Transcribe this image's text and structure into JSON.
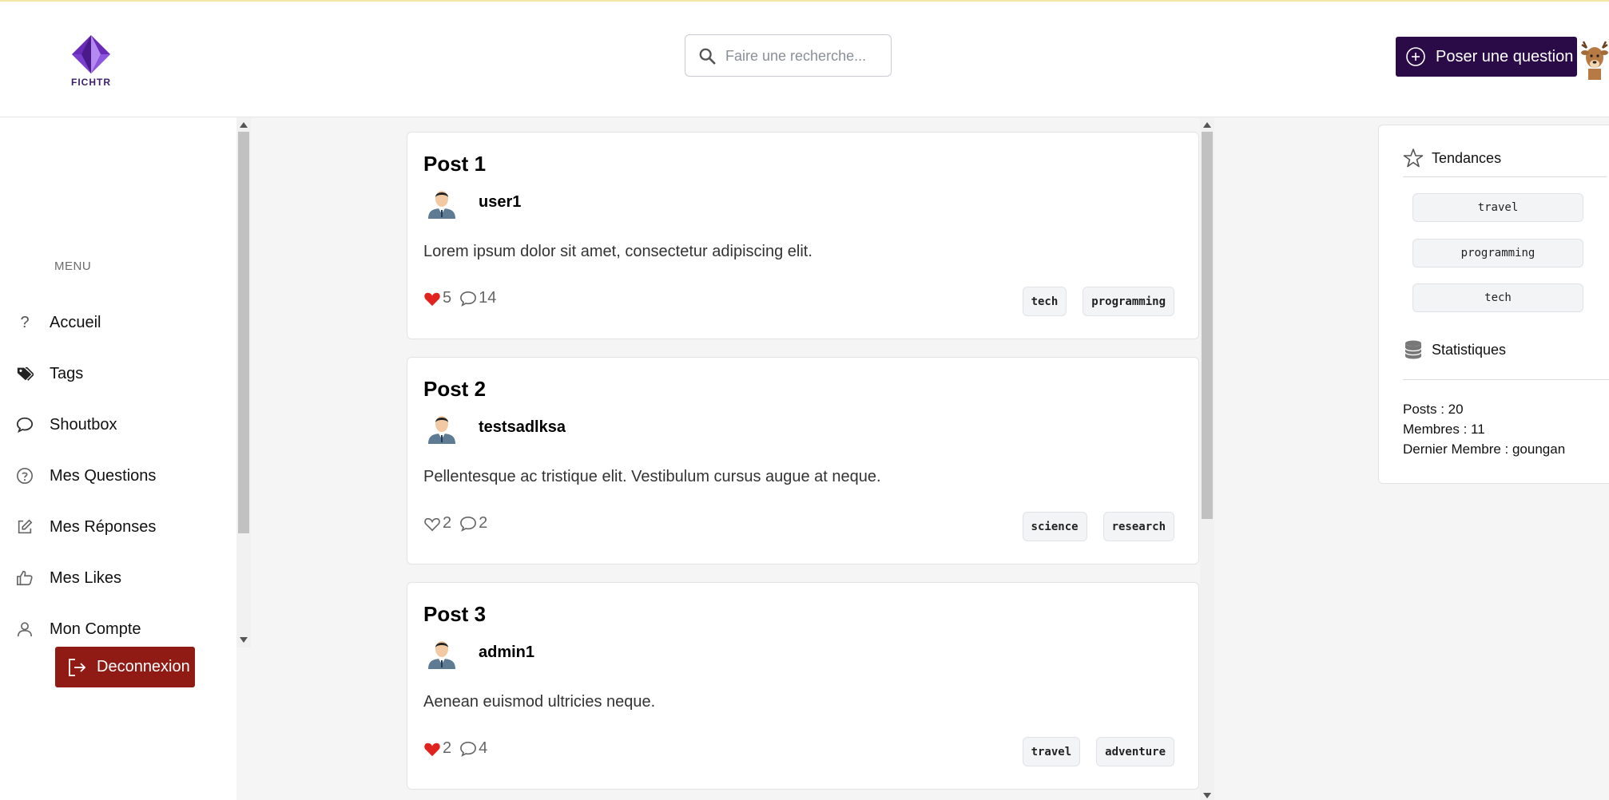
{
  "app": {
    "logo_text": "FICHTR"
  },
  "header": {
    "search_placeholder": "Faire une recherche...",
    "ask_button": "Poser une question"
  },
  "sidebar": {
    "menu_title": "MENU",
    "items": [
      {
        "label": "Accueil",
        "icon": "question-icon"
      },
      {
        "label": "Tags",
        "icon": "tags-icon"
      },
      {
        "label": "Shoutbox",
        "icon": "chat-bubble-icon"
      },
      {
        "label": "Mes Questions",
        "icon": "question-circle-icon"
      },
      {
        "label": "Mes Réponses",
        "icon": "edit-icon"
      },
      {
        "label": "Mes Likes",
        "icon": "thumbs-up-icon"
      },
      {
        "label": "Mon Compte",
        "icon": "user-icon"
      }
    ],
    "logout": "Deconnexion"
  },
  "posts": [
    {
      "title": "Post 1",
      "user": "user1",
      "body": "Lorem ipsum dolor sit amet, consectetur adipiscing elit.",
      "likes": "5",
      "liked": true,
      "comments": "14",
      "tags": [
        "tech",
        "programming"
      ]
    },
    {
      "title": "Post 2",
      "user": "testsadlksa",
      "body": "Pellentesque ac tristique elit. Vestibulum cursus augue at neque.",
      "likes": "2",
      "liked": false,
      "comments": "2",
      "tags": [
        "science",
        "research"
      ]
    },
    {
      "title": "Post 3",
      "user": "admin1",
      "body": "Aenean euismod ultricies neque.",
      "likes": "2",
      "liked": true,
      "comments": "4",
      "tags": [
        "travel",
        "adventure"
      ]
    }
  ],
  "panel": {
    "trends_title": "Tendances",
    "trends": [
      "travel",
      "programming",
      "tech"
    ],
    "stats_title": "Statistiques",
    "stats": [
      "Posts : 20",
      "Membres : 11",
      "Dernier Membre : goungan"
    ]
  },
  "colors": {
    "brand": "#2a0b47",
    "logout": "#8f1b14",
    "heart": "#e0231e"
  }
}
